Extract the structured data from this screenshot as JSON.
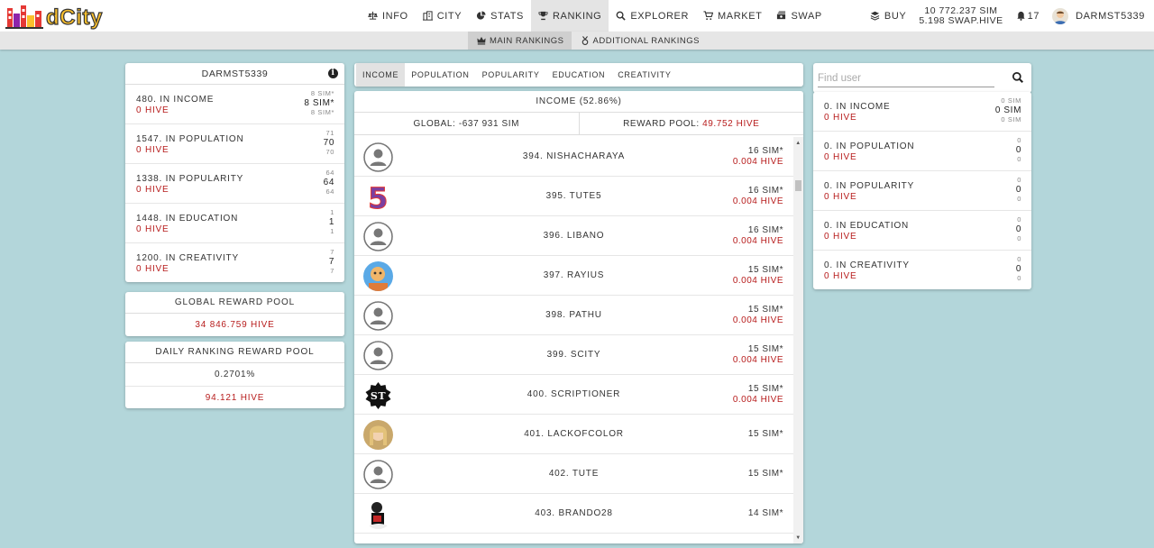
{
  "brand": {
    "logo_text": "dCity"
  },
  "nav": {
    "items": [
      {
        "label": "INFO",
        "icon": "balance-scale-icon"
      },
      {
        "label": "CITY",
        "icon": "building-icon"
      },
      {
        "label": "STATS",
        "icon": "pie-chart-icon"
      },
      {
        "label": "RANKING",
        "icon": "trophy-icon",
        "active": true
      },
      {
        "label": "EXPLORER",
        "icon": "search-icon"
      },
      {
        "label": "MARKET",
        "icon": "cart-icon"
      },
      {
        "label": "SWAP",
        "icon": "money-bill-icon"
      }
    ],
    "buy_label": "BUY",
    "balance_sim": "10 772.237 SIM",
    "balance_swap": "5.198 SWAP.HIVE",
    "notifications": "17",
    "username": "DARMST5339"
  },
  "subnav": {
    "items": [
      {
        "label": "MAIN RANKINGS",
        "active": true
      },
      {
        "label": "ADDITIONAL RANKINGS"
      }
    ]
  },
  "left_panel": {
    "title": "DARMST5339",
    "stats": [
      {
        "label": "480. IN INCOME",
        "hive": "0 HIVE",
        "top": "8 SIM*",
        "main": "8 SIM*",
        "bottom": "8 SIM*"
      },
      {
        "label": "1547. IN POPULATION",
        "hive": "0 HIVE",
        "top": "71",
        "main": "70",
        "bottom": "70"
      },
      {
        "label": "1338. IN POPULARITY",
        "hive": "0 HIVE",
        "top": "64",
        "main": "64",
        "bottom": "64"
      },
      {
        "label": "1448. IN EDUCATION",
        "hive": "0 HIVE",
        "top": "1",
        "main": "1",
        "bottom": "1"
      },
      {
        "label": "1200. IN CREATIVITY",
        "hive": "0 HIVE",
        "top": "7",
        "main": "7",
        "bottom": "7"
      }
    ],
    "global_pool": {
      "title": "GLOBAL REWARD POOL",
      "value": "34 846.759 HIVE"
    },
    "daily_pool": {
      "title": "DAILY RANKING REWARD POOL",
      "percent": "0.2701%",
      "value": "94.121 HIVE"
    }
  },
  "tabs": [
    "INCOME",
    "POPULATION",
    "POPULARITY",
    "EDUCATION",
    "CREATIVITY"
  ],
  "ranking": {
    "title": "INCOME (52.86%)",
    "global_label": "GLOBAL:",
    "global_value": "-637 931 SIM",
    "reward_label": "REWARD POOL:",
    "reward_value": "49.752 HIVE",
    "rows": [
      {
        "name": "394. NISHACHARAYA",
        "sim": "16 SIM*",
        "hive": "0.004 HIVE",
        "avatar": "default"
      },
      {
        "name": "395. TUTE5",
        "sim": "16 SIM*",
        "hive": "0.004 HIVE",
        "avatar": "five"
      },
      {
        "name": "396. LIBANO",
        "sim": "16 SIM*",
        "hive": "0.004 HIVE",
        "avatar": "default"
      },
      {
        "name": "397. RAYIUS",
        "sim": "15 SIM*",
        "hive": "0.004 HIVE",
        "avatar": "photo-blue"
      },
      {
        "name": "398. PATHU",
        "sim": "15 SIM*",
        "hive": "0.004 HIVE",
        "avatar": "default"
      },
      {
        "name": "399. SCITY",
        "sim": "15 SIM*",
        "hive": "0.004 HIVE",
        "avatar": "default"
      },
      {
        "name": "400. SCRIPTIONER",
        "sim": "15 SIM*",
        "hive": "0.004 HIVE",
        "avatar": "st-badge"
      },
      {
        "name": "401. LACKOFCOLOR",
        "sim": "15 SIM*",
        "hive": "",
        "avatar": "photo-blonde"
      },
      {
        "name": "402. TUTE",
        "sim": "15 SIM*",
        "hive": "",
        "avatar": "default"
      },
      {
        "name": "403. BRANDO28",
        "sim": "14 SIM*",
        "hive": "",
        "avatar": "photo-dark"
      }
    ]
  },
  "right_panel": {
    "search_placeholder": "Find user",
    "stats": [
      {
        "label": "0. IN INCOME",
        "hive": "0 HIVE",
        "top": "0 SIM",
        "main": "0 SIM",
        "bottom": "0 SIM"
      },
      {
        "label": "0. IN POPULATION",
        "hive": "0 HIVE",
        "top": "0",
        "main": "0",
        "bottom": "0"
      },
      {
        "label": "0. IN POPULARITY",
        "hive": "0 HIVE",
        "top": "0",
        "main": "0",
        "bottom": "0"
      },
      {
        "label": "0. IN EDUCATION",
        "hive": "0 HIVE",
        "top": "0",
        "main": "0",
        "bottom": "0"
      },
      {
        "label": "0. IN CREATIVITY",
        "hive": "0 HIVE",
        "top": "0",
        "main": "0",
        "bottom": "0"
      }
    ]
  },
  "colors": {
    "accent_red": "#b71c1c",
    "background": "#b3d6da",
    "logo_red": "#e53935",
    "logo_yellow": "#fbc02d"
  }
}
